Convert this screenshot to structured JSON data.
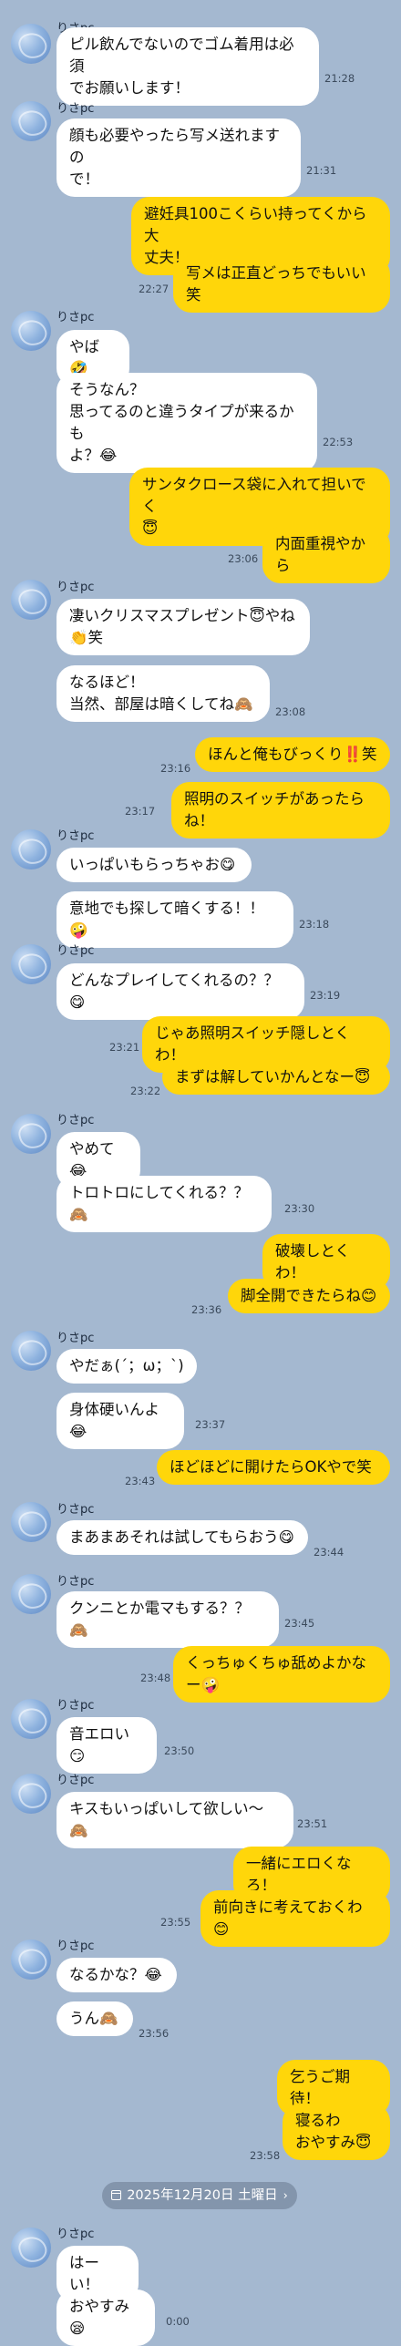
{
  "contact": {
    "name": "りさpc"
  },
  "date_separator": {
    "label": "2025年12月20日 土曜日",
    "chevron": "›"
  },
  "messages": [
    {
      "text": "ピル飲んでないのでゴム着用は必須\nでお願いします！",
      "time": "21:28"
    },
    {
      "text": "顔も必要やったら写メ送れますの\nで！",
      "time": "21:31"
    },
    {
      "text": "避妊具100こくらい持ってくから大\n丈夫！"
    },
    {
      "text": "写メは正直どっちでもいい笑",
      "time": "22:27"
    },
    {
      "text": "やば🤣"
    },
    {
      "text": "そうなん？\n思ってるのと違うタイプが来るかも\nよ？😂",
      "time": "22:53"
    },
    {
      "text": "サンタクロース袋に入れて担いでく\n😇"
    },
    {
      "text": "内面重視やから",
      "time": "23:06"
    },
    {
      "text": "凄いクリスマスプレゼント😇やね\n👏笑"
    },
    {
      "text": "なるほど！\n当然、部屋は暗くしてね🙈",
      "time": "23:08"
    },
    {
      "text": "ほんと俺もびっくり‼️笑",
      "time": "23:16"
    },
    {
      "text": "照明のスイッチがあったらね！",
      "time": "23:17"
    },
    {
      "text": "いっぱいもらっちゃお😋"
    },
    {
      "text": "意地でも探して暗くする！！🤪",
      "time": "23:18"
    },
    {
      "text": "どんなプレイしてくれるの？？😋",
      "time": "23:19"
    },
    {
      "text": "じゃあ照明スイッチ隠しとくわ！",
      "time": "23:21"
    },
    {
      "text": "まずは解していかんとなー😇",
      "time": "23:22"
    },
    {
      "text": "やめて😂"
    },
    {
      "text": "トロトロにしてくれる？？🙈",
      "time": "23:30"
    },
    {
      "text": "破壊しとくわ！"
    },
    {
      "text": "脚全開できたらね😊",
      "time": "23:36"
    },
    {
      "text": "やだぁ(´；ω；`)"
    },
    {
      "text": "身体硬いんよ😂",
      "time": "23:37"
    },
    {
      "text": "ほどほどに開けたらOKやで笑",
      "time": "23:43"
    },
    {
      "text": "まあまあそれは試してもらおう😋",
      "time": "23:44"
    },
    {
      "text": "クンニとか電マもする？？🙈",
      "time": "23:45"
    },
    {
      "text": "くっちゅくちゅ舐めよかなー🤪",
      "time": "23:48"
    },
    {
      "text": "音エロい😏",
      "time": "23:50"
    },
    {
      "text": "キスもいっぱいして欲しい〜🙈",
      "time": "23:51"
    },
    {
      "text": "一緒にエロくなろ！"
    },
    {
      "text": "前向きに考えておくわ😊",
      "time": "23:55"
    },
    {
      "text": "なるかな？😂"
    },
    {
      "text": "うん🙈",
      "time": "23:56"
    },
    {
      "text": "乞うご期待！"
    },
    {
      "text": "寝るわ\nおやすみ😇",
      "time": "23:58"
    },
    {
      "text": "はーい！"
    },
    {
      "text": "おやすみ😪",
      "time": "0:00"
    }
  ]
}
